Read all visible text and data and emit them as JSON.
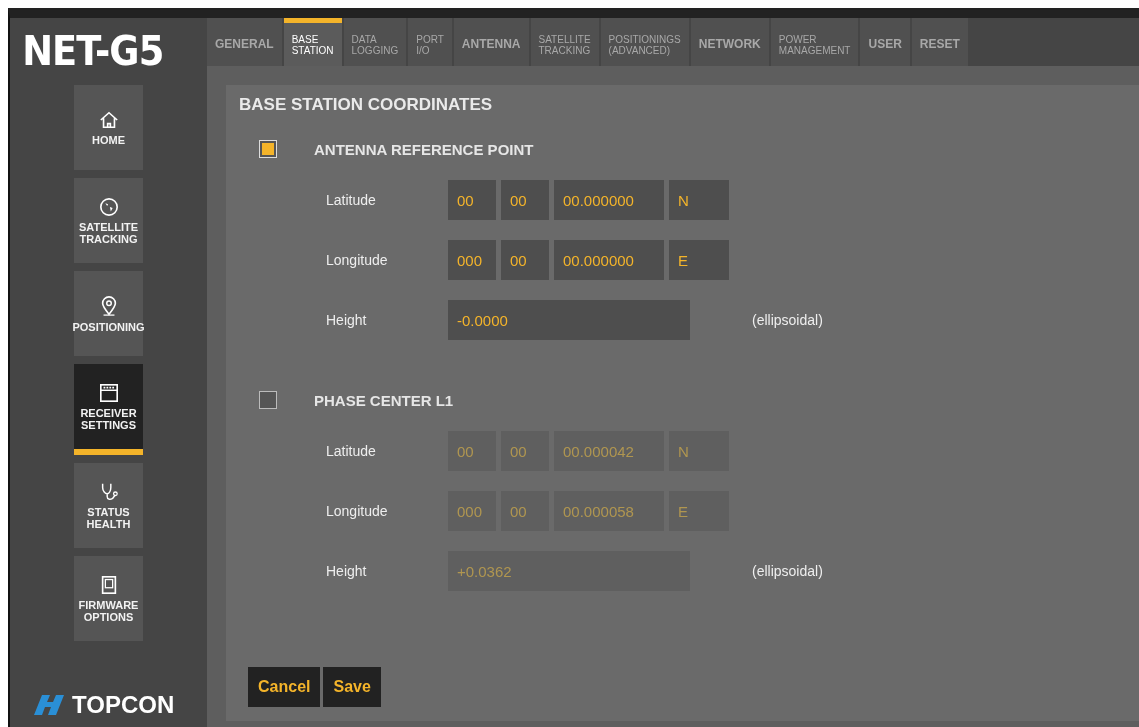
{
  "logo": "NET-G5",
  "tabs": [
    {
      "label": "GENERAL",
      "selected": false
    },
    {
      "label": "BASE\nSTATION",
      "selected": true
    },
    {
      "label": "DATA\nLOGGING",
      "selected": false
    },
    {
      "label": "PORT\nI/O",
      "selected": false
    },
    {
      "label": "ANTENNA",
      "selected": false
    },
    {
      "label": "SATELLITE\nTRACKING",
      "selected": false
    },
    {
      "label": "POSITIONINGS\n(ADVANCED)",
      "selected": false
    },
    {
      "label": "NETWORK",
      "selected": false
    },
    {
      "label": "POWER\nMANAGEMENT",
      "selected": false
    },
    {
      "label": "USER",
      "selected": false
    },
    {
      "label": "RESET",
      "selected": false
    }
  ],
  "sidebar": {
    "items": [
      {
        "kind": "home",
        "label": "HOME",
        "selected": false
      },
      {
        "kind": "globe",
        "label": "SATELLITE\nTRACKING",
        "selected": false
      },
      {
        "kind": "pin",
        "label": "POSITIONING",
        "selected": false
      },
      {
        "kind": "receiver",
        "label": "RECEIVER\nSETTINGS",
        "selected": true
      },
      {
        "kind": "stethoscope",
        "label": "STATUS\nHEALTH",
        "selected": false
      },
      {
        "kind": "device",
        "label": "FIRMWARE\nOPTIONS",
        "selected": false
      }
    ],
    "brand": "TOPCON"
  },
  "panel": {
    "title": "BASE STATION COORDINATES",
    "sections": [
      {
        "title": "ANTENNA REFERENCE POINT",
        "checked": true,
        "rows": [
          {
            "kind": "coord",
            "label": "Latitude",
            "fields": [
              "00",
              "00",
              "00.000000",
              "N"
            ]
          },
          {
            "kind": "coord",
            "label": "Longitude",
            "fields": [
              "000",
              "00",
              "00.000000",
              "E"
            ]
          },
          {
            "kind": "height",
            "label": "Height",
            "value": "-0.0000",
            "note": "(ellipsoidal)"
          }
        ]
      },
      {
        "title": "PHASE CENTER L1",
        "checked": false,
        "rows": [
          {
            "kind": "coord",
            "label": "Latitude",
            "fields": [
              "00",
              "00",
              "00.000042",
              "N"
            ]
          },
          {
            "kind": "coord",
            "label": "Longitude",
            "fields": [
              "000",
              "00",
              "00.000058",
              "E"
            ]
          },
          {
            "kind": "height",
            "label": "Height",
            "value": "+0.0362",
            "note": "(ellipsoidal)"
          }
        ]
      }
    ],
    "buttons": [
      "Cancel",
      "Save"
    ]
  }
}
